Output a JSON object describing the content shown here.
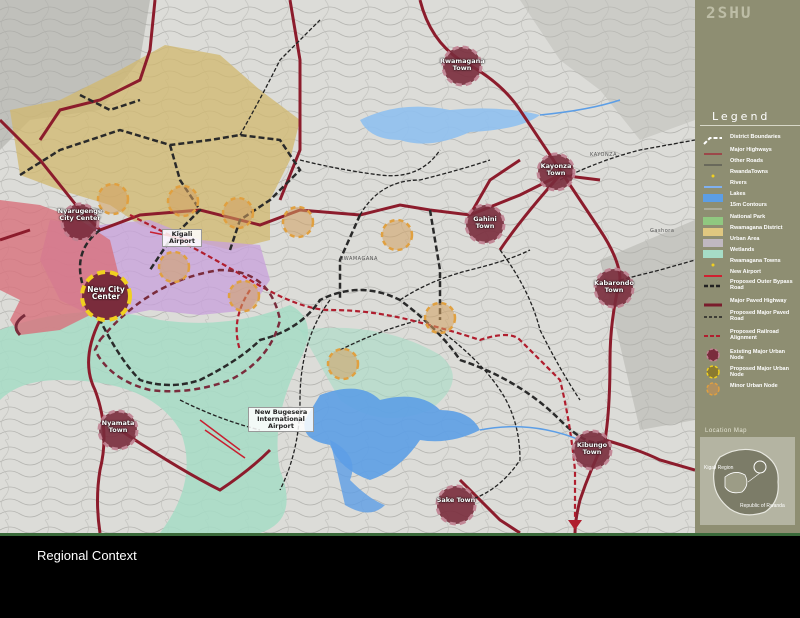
{
  "brand": "2SHU",
  "caption": "Regional Context",
  "legend": {
    "title": "Legend",
    "items": [
      {
        "label": "District Boundaries",
        "symbol": "district"
      },
      {
        "label": "Major Highways",
        "symbol": "highway-thin"
      },
      {
        "label": "Other Roads",
        "symbol": "road"
      },
      {
        "label": "RwandaTowns",
        "symbol": "town-dot"
      },
      {
        "label": "Rivers",
        "symbol": "river"
      },
      {
        "label": "Lakes",
        "symbol": "lake"
      },
      {
        "label": "15m Contours",
        "symbol": "contour"
      },
      {
        "label": "National Park",
        "symbol": "park"
      },
      {
        "label": "Rwamagana District",
        "symbol": "district-fill"
      },
      {
        "label": "Urban Area",
        "symbol": "urban"
      },
      {
        "label": "Wetlands",
        "symbol": "wetland"
      },
      {
        "label": "Rwamagana Towns",
        "symbol": "town-dot"
      },
      {
        "label": "New Airport",
        "symbol": "airport"
      },
      {
        "label": "Proposed Outer Bypass Road",
        "symbol": "bypass"
      },
      {
        "label": "Major Paved Highway",
        "symbol": "paved"
      },
      {
        "label": "Proposed Major Paved Road",
        "symbol": "proposed-road"
      },
      {
        "label": "Proposed Railroad Alignment",
        "symbol": "railroad"
      },
      {
        "label": "Existing Major Urban Node",
        "symbol": "node-major"
      },
      {
        "label": "Proposed Major Urban Node",
        "symbol": "node-proposed"
      },
      {
        "label": "Minor Urban Node",
        "symbol": "node-minor"
      }
    ]
  },
  "location_map": {
    "title": "Location Map",
    "labels": [
      "Kigali Region",
      "Republic of Rwanda"
    ]
  },
  "map_labels": {
    "rwamagana": "Rwamagana Town",
    "nyarugenge": "Nyarugenge City Center",
    "kigali_airport": "Kigali Airport",
    "new_city": "New City Center",
    "nyamata": "Nyamata Town",
    "bugesera": "New Bugesera International Airport",
    "kayonza": "Kayonza Town",
    "kabarondo": "Kabarondo Town",
    "kibungo": "Kibungo Town",
    "sake": "Sake Town",
    "gahini": "Gahini Town"
  },
  "place_names": [
    "KAYONZA",
    "RWAMAGANA",
    "Gashora"
  ],
  "colors": {
    "highway": "#8c1c2c",
    "district_fill": "#d2b86e",
    "urban_fill": "#c8a0dc",
    "city_fill": "#d8707c",
    "wetland": "#a6dcc6",
    "lake": "#5c9ee6",
    "node_major": "#7a2c3c",
    "node_proposed": "#f0d020",
    "node_minor": "#e0a040",
    "panel": "#8e8e72"
  }
}
